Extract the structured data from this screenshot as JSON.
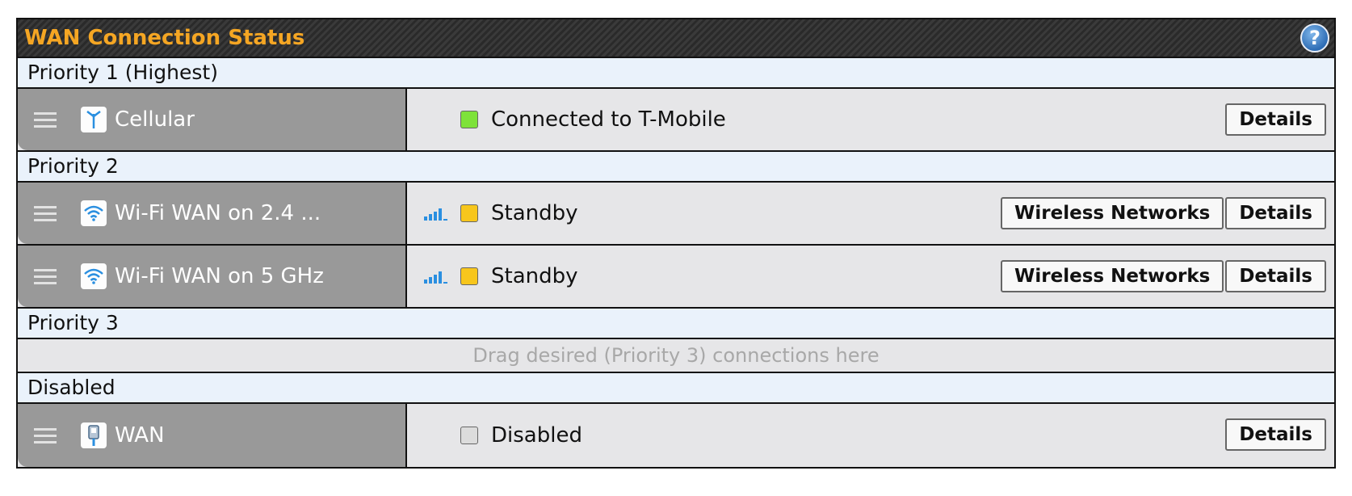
{
  "panel": {
    "title": "WAN Connection Status",
    "help_icon": "question-circle-icon",
    "help_label": "?"
  },
  "groups": [
    {
      "label": "Priority 1 (Highest)",
      "connections": [
        {
          "name": "Cellular",
          "icon": "cellular-antenna-icon",
          "show_signal": false,
          "status_color": "#7ee23a",
          "status": "Connected to T-Mobile",
          "buttons": [
            "Details"
          ]
        }
      ]
    },
    {
      "label": "Priority 2",
      "connections": [
        {
          "name": "Wi-Fi WAN on 2.4 ...",
          "icon": "wifi-icon",
          "show_signal": true,
          "status_color": "#f7c61c",
          "status": "Standby",
          "buttons": [
            "Wireless Networks",
            "Details"
          ]
        },
        {
          "name": "Wi-Fi WAN on 5 GHz",
          "icon": "wifi-icon",
          "show_signal": true,
          "status_color": "#f7c61c",
          "status": "Standby",
          "buttons": [
            "Wireless Networks",
            "Details"
          ]
        }
      ]
    },
    {
      "label": "Priority 3",
      "connections": [],
      "drop_hint": "Drag desired (Priority 3) connections here"
    },
    {
      "label": "Disabled",
      "connections": [
        {
          "name": "WAN",
          "icon": "ethernet-plug-icon",
          "show_signal": false,
          "status_color": "#dcdcdc",
          "status": "Disabled",
          "buttons": [
            "Details"
          ]
        }
      ]
    }
  ],
  "colors": {
    "title": "#f5a623",
    "priority_header_bg": "#eaf2fb",
    "name_cell_bg": "#999999",
    "status_cell_bg": "#e6e6e8"
  }
}
